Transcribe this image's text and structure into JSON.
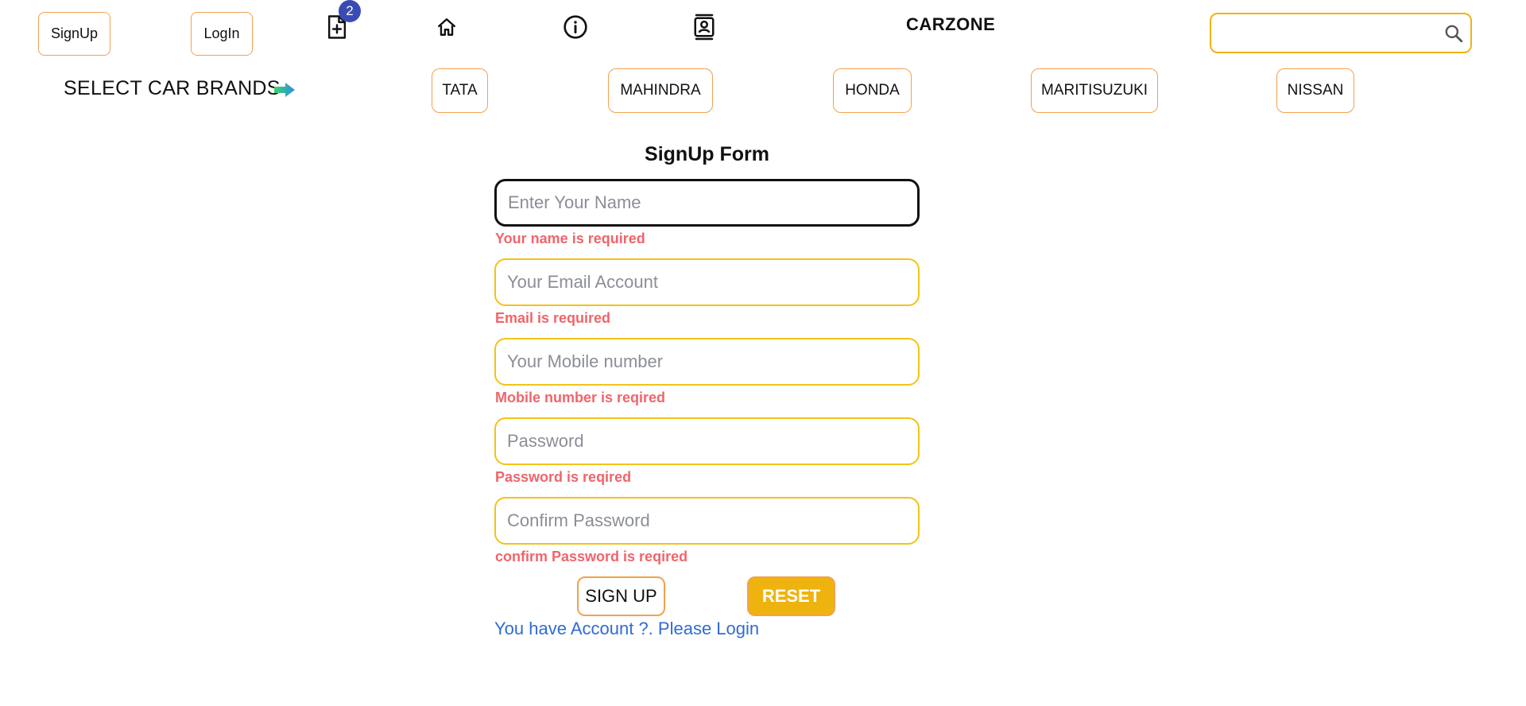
{
  "header": {
    "signup_label": "SignUp",
    "login_label": "LogIn",
    "cart_badge": "2",
    "brand": "CARZONE",
    "search": {
      "value": "",
      "placeholder": ""
    },
    "icons": [
      "file-add-icon",
      "home-icon",
      "info-icon",
      "contact-icon",
      "search-icon"
    ]
  },
  "brands_bar": {
    "label": "SELECT CAR BRANDS",
    "arrow_icon": "arrow-right-icon",
    "items": [
      {
        "label": "TATA"
      },
      {
        "label": "MAHINDRA"
      },
      {
        "label": "HONDA"
      },
      {
        "label": "MARITISUZUKI"
      },
      {
        "label": "NISSAN"
      }
    ]
  },
  "form": {
    "title": "SignUp Form",
    "fields": [
      {
        "placeholder": "Enter Your Name",
        "value": "",
        "error": "Your name is required"
      },
      {
        "placeholder": "Your Email Account",
        "value": "",
        "error": "Email is required"
      },
      {
        "placeholder": "Your Mobile number",
        "value": "",
        "error": "Mobile number is reqired"
      },
      {
        "placeholder": "Password",
        "value": "",
        "error": "Password is reqired"
      },
      {
        "placeholder": "Confirm Password",
        "value": "",
        "error": "confirm Password is reqired"
      }
    ],
    "signup_button": "SIGN UP",
    "reset_button": "RESET",
    "login_link": "You have Account ?. Please Login"
  },
  "colors": {
    "accent_border": "#f3a14d",
    "field_border": "#f2c318",
    "error": "#f0656a",
    "reset_bg": "#efb30f",
    "link": "#2f6bd6",
    "badge_bg": "#3b4bb6"
  }
}
